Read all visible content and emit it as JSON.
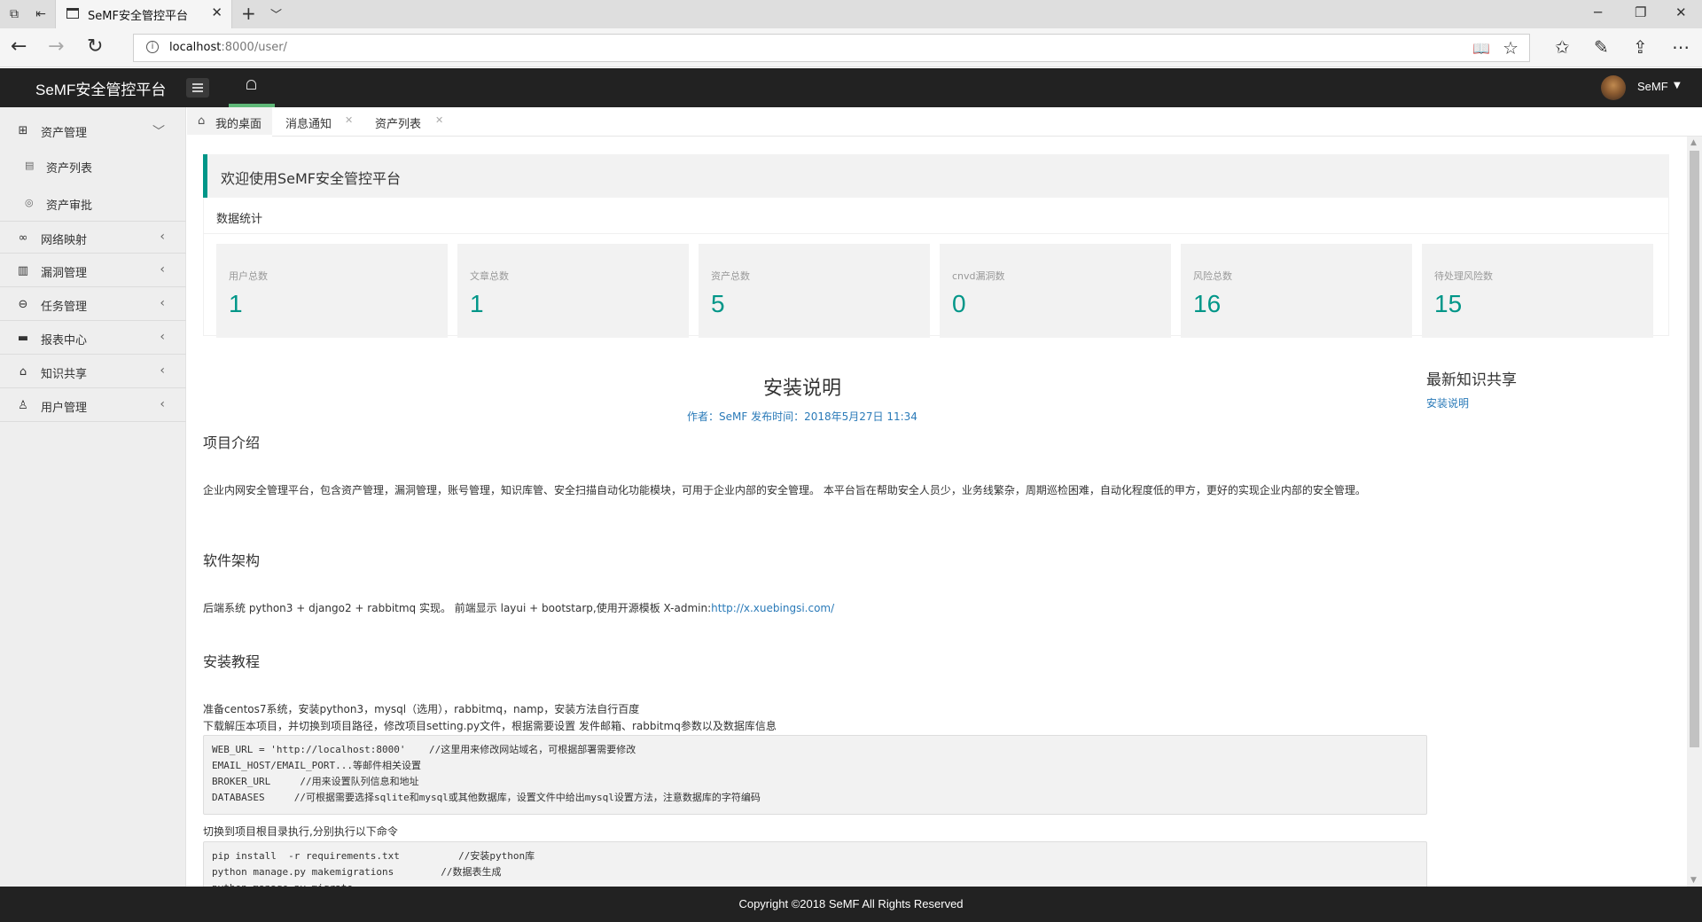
{
  "browser": {
    "tab_title": "SeMF安全管控平台",
    "url_host": "localhost",
    "url_rest": ":8000/user/"
  },
  "header": {
    "logo": "SeMF安全管控平台",
    "user_name": "SeMF"
  },
  "sidebar": {
    "items": [
      {
        "label": "资产管理",
        "icon": "asset-icon",
        "arrow": "﹀"
      },
      {
        "label": "网络映射",
        "icon": "network-icon",
        "arrow": "‹"
      },
      {
        "label": "漏洞管理",
        "icon": "vuln-icon",
        "arrow": "‹"
      },
      {
        "label": "任务管理",
        "icon": "task-icon",
        "arrow": "‹"
      },
      {
        "label": "报表中心",
        "icon": "report-icon",
        "arrow": "‹"
      },
      {
        "label": "知识共享",
        "icon": "book-icon",
        "arrow": "‹"
      },
      {
        "label": "用户管理",
        "icon": "user-icon",
        "arrow": "‹"
      }
    ],
    "subitems": [
      {
        "label": "资产列表",
        "icon": "list-icon"
      },
      {
        "label": "资产审批",
        "icon": "approve-icon"
      }
    ]
  },
  "tabs": [
    {
      "label": "我的桌面"
    },
    {
      "label": "消息通知"
    },
    {
      "label": "资产列表"
    }
  ],
  "welcome": "欢迎使用SeMF安全管控平台",
  "stats": {
    "title": "数据统计",
    "cards": [
      {
        "label": "用户总数",
        "value": "1"
      },
      {
        "label": "文章总数",
        "value": "1"
      },
      {
        "label": "资产总数",
        "value": "5"
      },
      {
        "label": "cnvd漏洞数",
        "value": "0"
      },
      {
        "label": "风险总数",
        "value": "16"
      },
      {
        "label": "待处理风险数",
        "value": "15"
      }
    ]
  },
  "article": {
    "title": "安装说明",
    "meta": "作者：SeMF 发布时间：2018年5月27日 11:34",
    "sec1_title": "项目介绍",
    "sec1_text": "企业内网安全管理平台，包含资产管理，漏洞管理，账号管理，知识库管、安全扫描自动化功能模块，可用于企业内部的安全管理。 本平台旨在帮助安全人员少，业务线繁杂，周期巡检困难，自动化程度低的甲方，更好的实现企业内部的安全管理。",
    "sec2_title": "软件架构",
    "sec2_text": "后端系统 python3 + django2 + rabbitmq 实现。 前端显示 layui + bootstarp,使用开源模板 X-admin:",
    "sec2_link": "http://x.xuebingsi.com/",
    "sec3_title": "安装教程",
    "sec3_line1": "准备centos7系统，安装python3，mysql（选用），rabbitmq，namp，安装方法自行百度",
    "sec3_line2": "下载解压本项目，并切换到项目路径，修改项目setting.py文件，根据需要设置 发件邮箱、rabbitmq参数以及数据库信息",
    "code1": "WEB_URL = 'http://localhost:8000'    //这里用来修改网站域名，可根据部署需要修改\nEMAIL_HOST/EMAIL_PORT...等邮件相关设置\nBROKER_URL     //用来设置队列信息和地址\nDATABASES     //可根据需要选择sqlite和mysql或其他数据库，设置文件中给出mysql设置方法，注意数据库的字符编码",
    "sec3_line3": "切换到项目根目录执行,分别执行以下命令",
    "code2": "pip install  -r requirements.txt          //安装python库\npython manage.py makemigrations        //数据表生成\npython manage.py migrate"
  },
  "knowledge": {
    "title": "最新知识共享",
    "link": "安装说明"
  },
  "footer": "Copyright ©2018 SeMF All Rights Reserved"
}
